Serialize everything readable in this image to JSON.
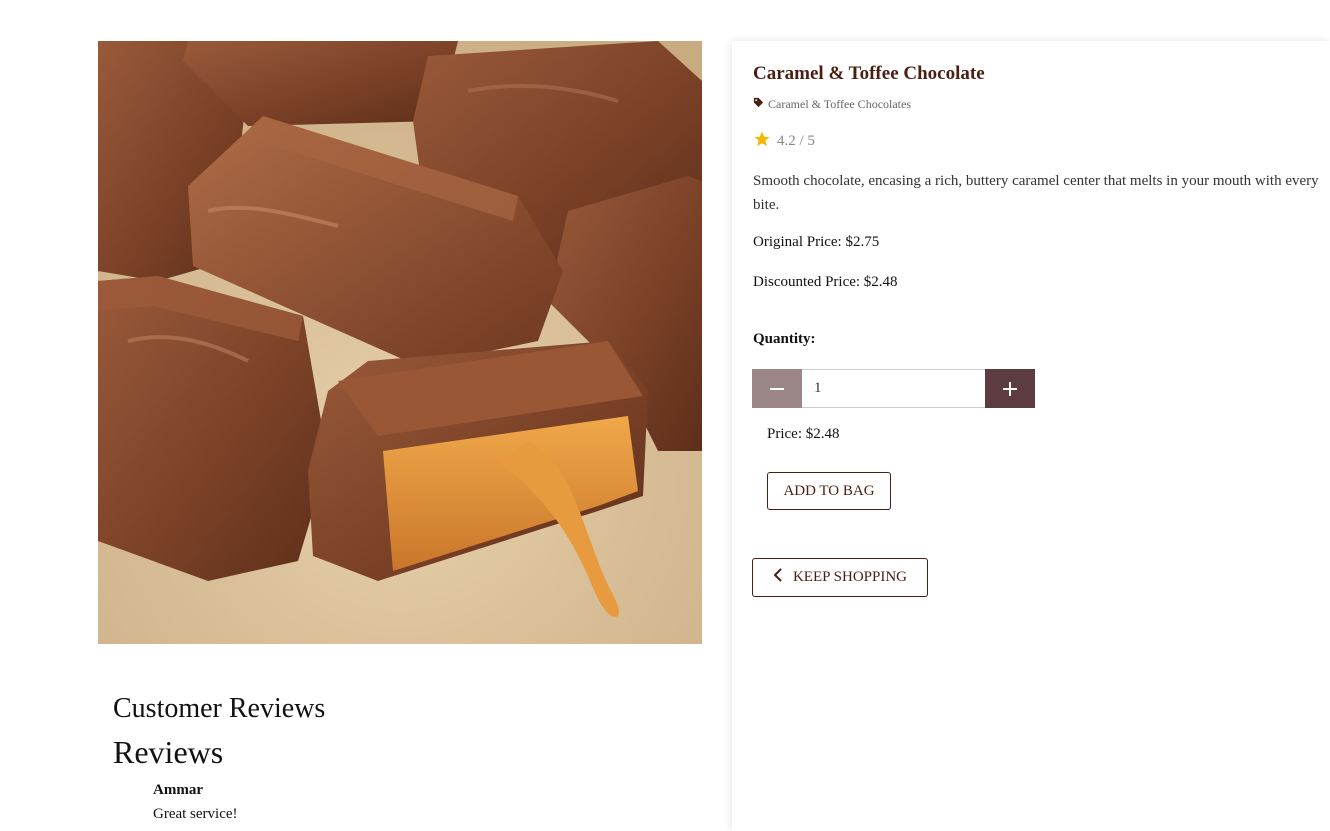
{
  "product": {
    "title": "Caramel & Toffee Chocolate",
    "category": "Caramel & Toffee Chocolates",
    "rating": "4.2 / 5",
    "description": "Smooth chocolate, encasing a rich, buttery caramel center that melts in your mouth with every bite.",
    "original_price": "Original Price: $2.75",
    "discounted_price": "Discounted Price: $2.48"
  },
  "quantity": {
    "label": "Quantity:",
    "value": "1",
    "minus": "−",
    "plus": "+"
  },
  "line_price": "Price: $2.48",
  "buttons": {
    "add_to_bag": "ADD TO BAG",
    "keep_shopping": "KEEP SHOPPING"
  },
  "reviews": {
    "heading": "Customer Reviews",
    "subheading": "Reviews",
    "items": [
      {
        "author": "Ammar",
        "text": "Great service!"
      }
    ]
  },
  "colors": {
    "title": "#4a1f12",
    "star": "#f5b800",
    "minus_button": "#9b8688",
    "plus_button": "#5c3b41"
  },
  "icons": {
    "category": "tag-icon",
    "rating": "star-icon",
    "back": "chevron-left-icon"
  }
}
